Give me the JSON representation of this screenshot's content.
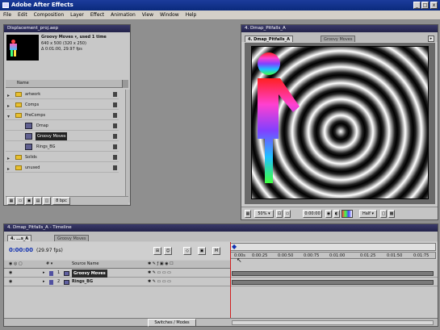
{
  "app": {
    "title": "Adobe After Effects",
    "minimize": "_",
    "maximize": "□",
    "close": "x"
  },
  "menu": [
    "File",
    "Edit",
    "Composition",
    "Layer",
    "Effect",
    "Animation",
    "View",
    "Window",
    "Help"
  ],
  "project": {
    "title": "Displacement_proj.aep",
    "preview": {
      "name": "Groovy Moves ▾, used 1 time",
      "dims": "640 x 500 (320 x 250)",
      "duration": "Δ 0:01:00, 29.97 fps"
    },
    "column_name": "Name",
    "items": [
      {
        "label": "artwork"
      },
      {
        "label": "Comps"
      },
      {
        "label": "PreComps"
      },
      {
        "label": "Dmap"
      },
      {
        "label": "Groovy Moves"
      },
      {
        "label": "Rings_BG"
      },
      {
        "label": "Solids"
      },
      {
        "label": "unused"
      }
    ],
    "bit_depth": "8 bpc"
  },
  "comp_window": {
    "title": "4. Dmap_Pitfalls_A",
    "tab_active": "4. Dmap_Pitfalls_A",
    "tab_inactive": "Groovy Moves",
    "zoom": "50%",
    "timecode": "0:00:00",
    "resolution": "Half"
  },
  "timeline": {
    "title": "4. Dmap_Pitfalls_A - Timeline",
    "tab_active": "4. ...s_A",
    "tab_inactive": "Groovy Moves",
    "current_time": "0:00:00",
    "fps": "(29.97 fps)",
    "col_source": "Source Name",
    "ruler": [
      "0:00s",
      "0:00:25",
      "0:00:50",
      "0:00:75",
      "0:01:00",
      "0:01:25",
      "0:01:50",
      "0:01:75"
    ],
    "layers": [
      {
        "num": "1",
        "name": "Groovy Moves"
      },
      {
        "num": "2",
        "name": "Rings_BG"
      }
    ],
    "switches_modes": "Switches / Modes"
  }
}
